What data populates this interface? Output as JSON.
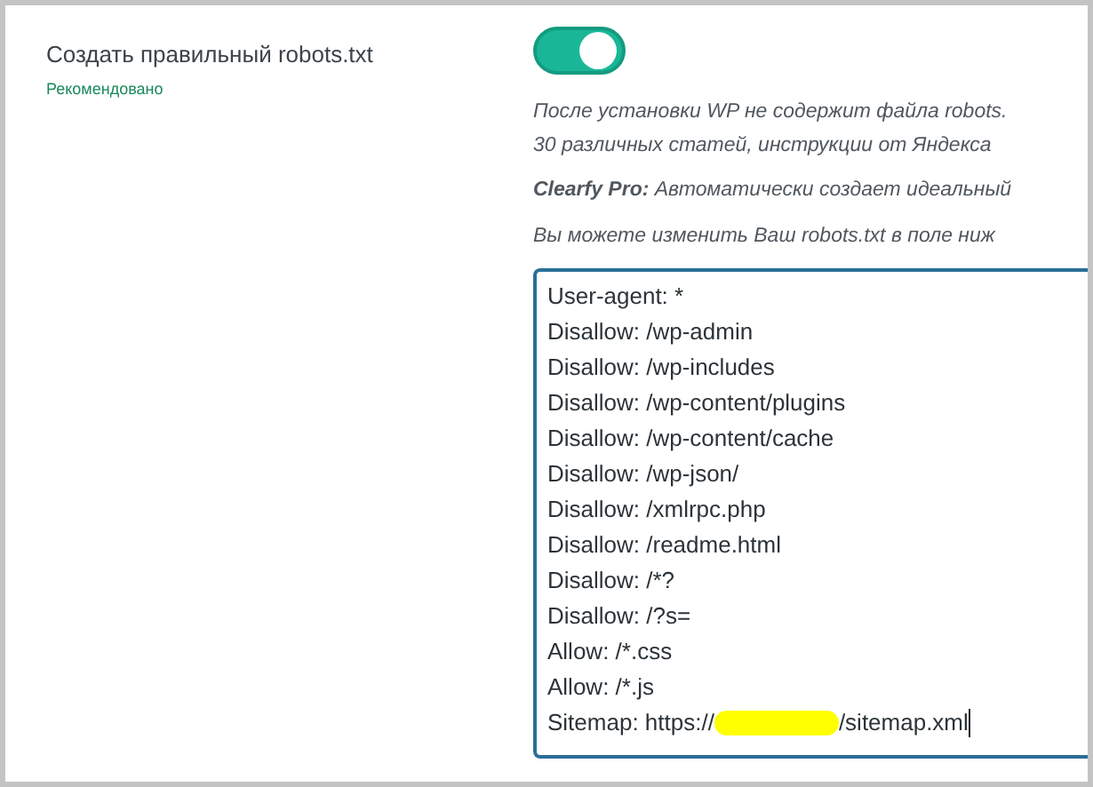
{
  "setting": {
    "label": "Создать правильный robots.txt",
    "badge": "Рекомендовано",
    "toggle": {
      "on": true
    }
  },
  "description": [
    {
      "text": "После установки WP не содержит файла robots."
    },
    {
      "text": "30 различных статей, инструкции от Яндекса"
    },
    {
      "text": "**Clearfy Pro:** Автоматически создает идеальный"
    },
    {
      "text": "Вы можете изменить Ваш robots.txt в поле ниж"
    }
  ],
  "editor": {
    "lines": [
      {
        "text": "User-agent: *"
      },
      {
        "text": "Disallow: /wp-admin"
      },
      {
        "text": "Disallow: /wp-includes"
      },
      {
        "text": "Disallow: /wp-content/plugins"
      },
      {
        "text": "Disallow: /wp-content/cache"
      },
      {
        "text": "Disallow: /wp-json/"
      },
      {
        "text": "Disallow: /xmlrpc.php"
      },
      {
        "text": "Disallow: /readme.html"
      },
      {
        "text": "Disallow: /*?"
      },
      {
        "text": "Disallow: /?s="
      },
      {
        "text": "Allow: /*.css"
      },
      {
        "text": "Allow: /*.js"
      },
      {
        "text": "Sitemap: https://",
        "redacted": true,
        "after": "/sitemap.xml"
      }
    ]
  }
}
